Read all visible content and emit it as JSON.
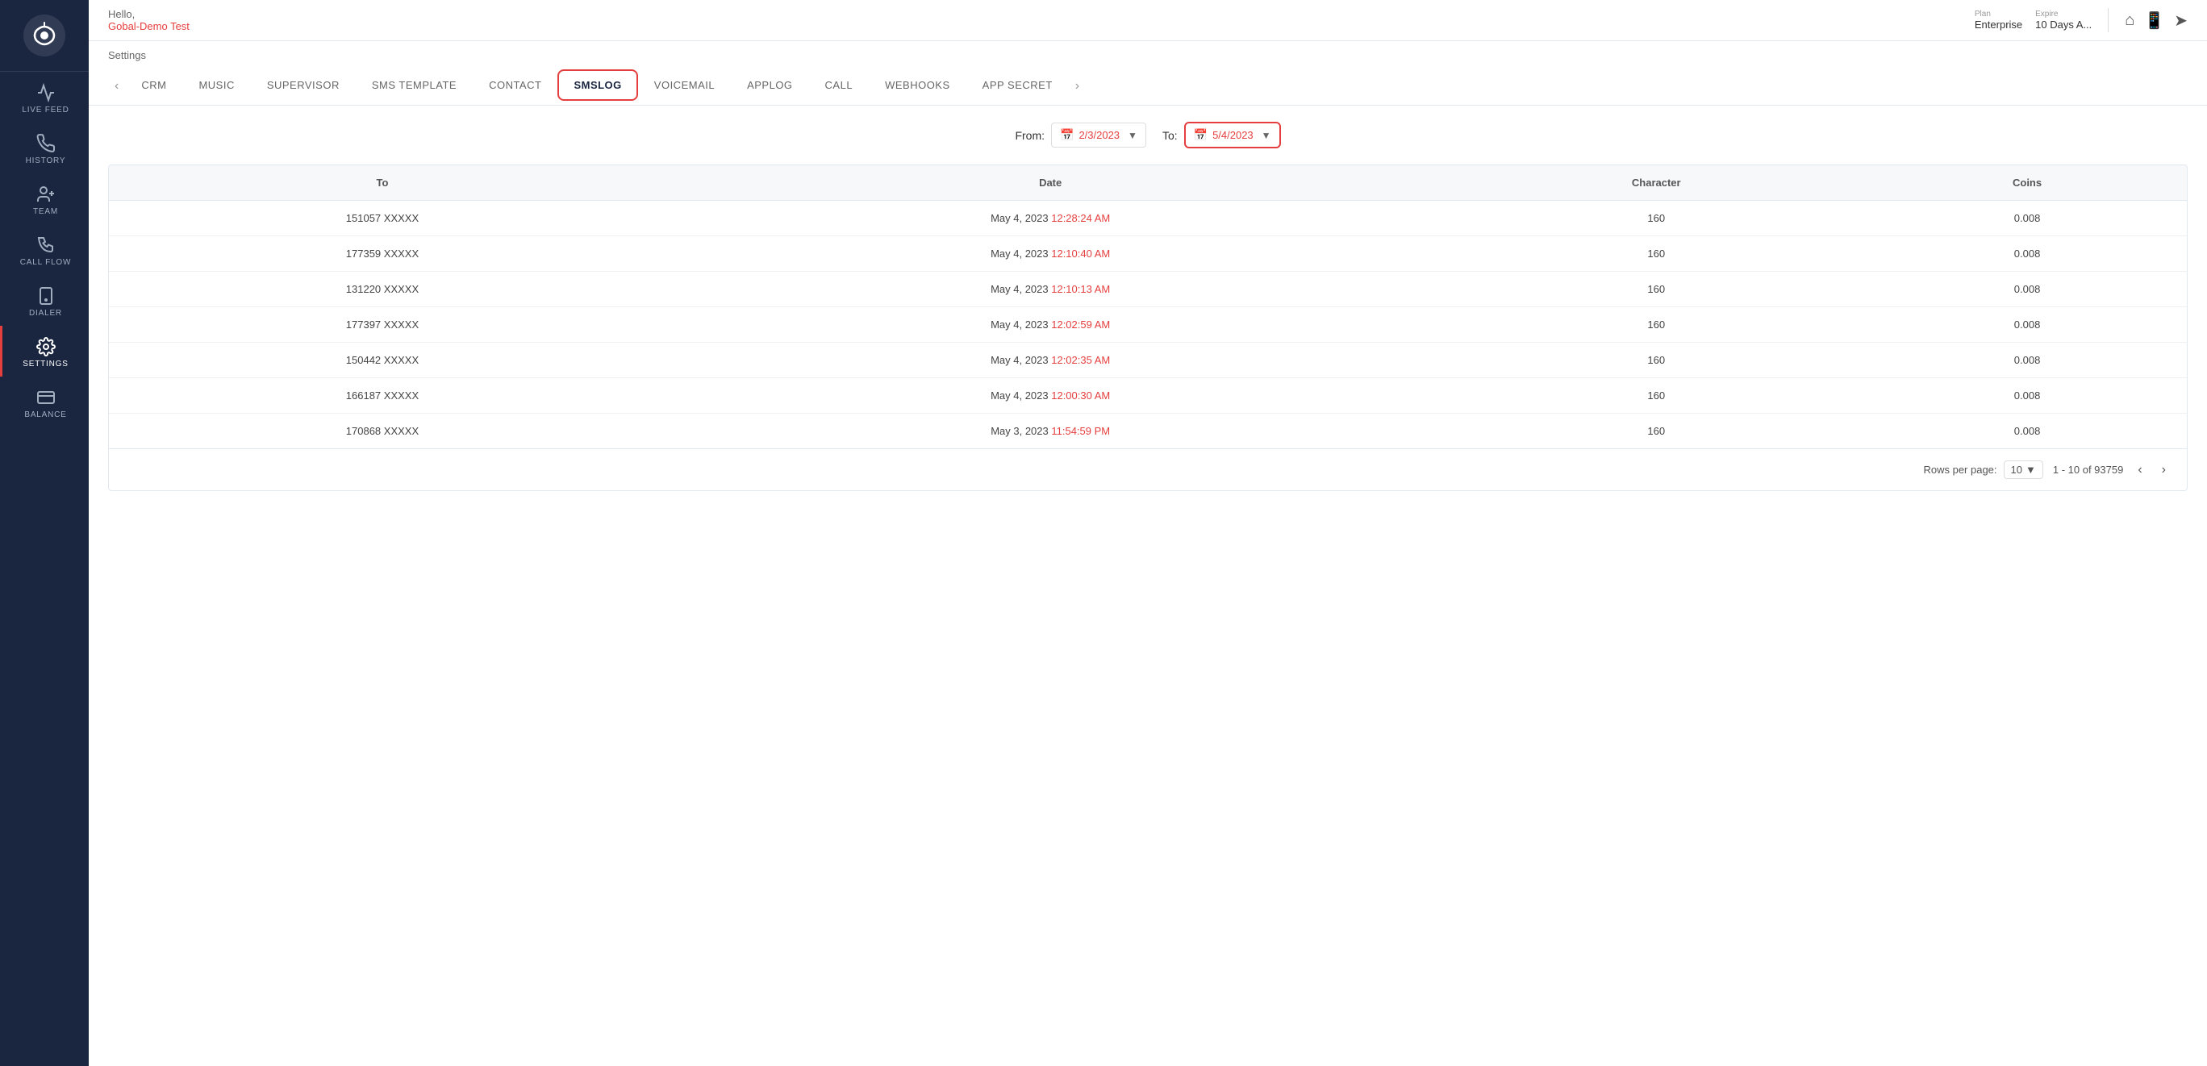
{
  "topbar": {
    "hello": "Hello,",
    "username": "Gobal-Demo Test",
    "plan_label": "Plan",
    "plan_value": "Enterprise",
    "expire_label": "Expire",
    "expire_value": "10 Days A..."
  },
  "settings_title": "Settings",
  "nav_tabs": [
    {
      "id": "crm",
      "label": "CRM",
      "active": false
    },
    {
      "id": "music",
      "label": "MUSIC",
      "active": false
    },
    {
      "id": "supervisor",
      "label": "SUPERVISOR",
      "active": false
    },
    {
      "id": "sms_template",
      "label": "SMS TEMPLATE",
      "active": false
    },
    {
      "id": "contact",
      "label": "CONTACT",
      "active": false
    },
    {
      "id": "smslog",
      "label": "SMSLOG",
      "active": true
    },
    {
      "id": "voicemail",
      "label": "VOICEMAIL",
      "active": false
    },
    {
      "id": "applog",
      "label": "APPLOG",
      "active": false
    },
    {
      "id": "call",
      "label": "CALL",
      "active": false
    },
    {
      "id": "webhooks",
      "label": "WEBHOOKS",
      "active": false
    },
    {
      "id": "app_secret",
      "label": "APP SECRET",
      "active": false
    }
  ],
  "filter": {
    "from_label": "From:",
    "from_date": "2/3/2023",
    "to_label": "To:",
    "to_date": "5/4/2023"
  },
  "table": {
    "columns": [
      "To",
      "Date",
      "Character",
      "Coins"
    ],
    "rows": [
      {
        "to": "151057 XXXXX",
        "date_part": "May 4, 2023",
        "time_part": "12:28:24 AM",
        "character": "160",
        "coins": "0.008"
      },
      {
        "to": "177359 XXXXX",
        "date_part": "May 4, 2023",
        "time_part": "12:10:40 AM",
        "character": "160",
        "coins": "0.008"
      },
      {
        "to": "131220 XXXXX",
        "date_part": "May 4, 2023",
        "time_part": "12:10:13 AM",
        "character": "160",
        "coins": "0.008"
      },
      {
        "to": "177397 XXXXX",
        "date_part": "May 4, 2023",
        "time_part": "12:02:59 AM",
        "character": "160",
        "coins": "0.008"
      },
      {
        "to": "150442 XXXXX",
        "date_part": "May 4, 2023",
        "time_part": "12:02:35 AM",
        "character": "160",
        "coins": "0.008"
      },
      {
        "to": "166187 XXXXX",
        "date_part": "May 4, 2023",
        "time_part": "12:00:30 AM",
        "character": "160",
        "coins": "0.008"
      },
      {
        "to": "170868 XXXXX",
        "date_part": "May 3, 2023",
        "time_part": "11:54:59 PM",
        "character": "160",
        "coins": "0.008"
      }
    ]
  },
  "pagination": {
    "rows_per_page_label": "Rows per page:",
    "rows_per_page_value": "10",
    "range": "1 - 10 of 93759"
  },
  "sidebar": {
    "items": [
      {
        "id": "live_feed",
        "label": "LIVE FEED"
      },
      {
        "id": "history",
        "label": "HISTORY"
      },
      {
        "id": "team",
        "label": "TEAM"
      },
      {
        "id": "call_flow",
        "label": "CALL FLOW"
      },
      {
        "id": "dialer",
        "label": "DIALER"
      },
      {
        "id": "settings",
        "label": "SETTINGS"
      },
      {
        "id": "balance",
        "label": "BALANCE"
      }
    ]
  }
}
